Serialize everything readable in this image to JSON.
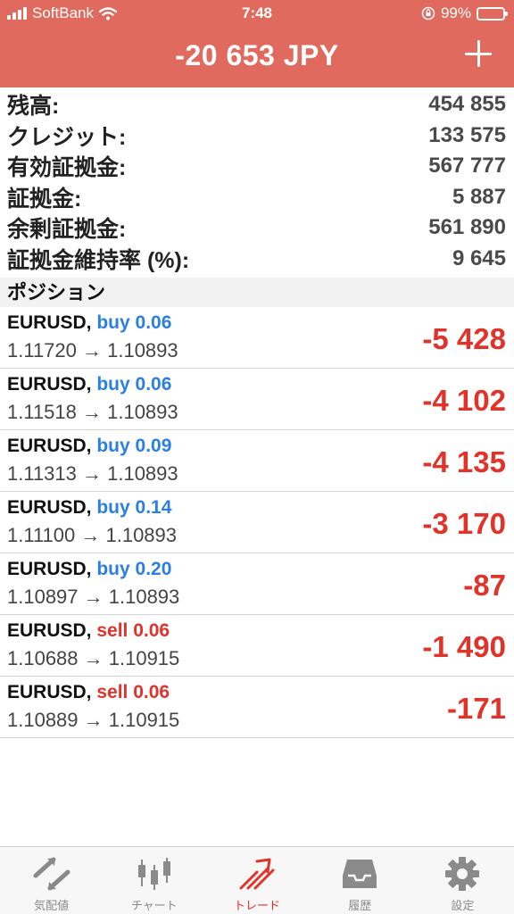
{
  "status_bar": {
    "carrier": "SoftBank",
    "time": "7:48",
    "battery": "99%"
  },
  "header": {
    "total": "-20 653 JPY"
  },
  "summary": [
    {
      "label": "残高:",
      "value": "454 855"
    },
    {
      "label": "クレジット:",
      "value": "133 575"
    },
    {
      "label": "有効証拠金:",
      "value": "567 777"
    },
    {
      "label": "証拠金:",
      "value": "5 887"
    },
    {
      "label": "余剰証拠金:",
      "value": "561 890"
    },
    {
      "label": "証拠金維持率 (%):",
      "value": "9 645"
    }
  ],
  "positions_title": "ポジション",
  "positions": [
    {
      "symbol": "EURUSD,",
      "side": "buy 0.06",
      "prices": "1.11720 → 1.10893",
      "profit": "-5 428"
    },
    {
      "symbol": "EURUSD,",
      "side": "buy 0.06",
      "prices": "1.11518 → 1.10893",
      "profit": "-4 102"
    },
    {
      "symbol": "EURUSD,",
      "side": "buy 0.09",
      "prices": "1.11313 → 1.10893",
      "profit": "-4 135"
    },
    {
      "symbol": "EURUSD,",
      "side": "buy 0.14",
      "prices": "1.11100 → 1.10893",
      "profit": "-3 170"
    },
    {
      "symbol": "EURUSD,",
      "side": "buy 0.20",
      "prices": "1.10897 → 1.10893",
      "profit": "-87"
    },
    {
      "symbol": "EURUSD,",
      "side": "sell 0.06",
      "prices": "1.10688 → 1.10915",
      "profit": "-1 490"
    },
    {
      "symbol": "EURUSD,",
      "side": "sell 0.06",
      "prices": "1.10889 → 1.10915",
      "profit": "-171"
    }
  ],
  "tabs": [
    {
      "label": "気配値",
      "icon": "quotes-icon"
    },
    {
      "label": "チャート",
      "icon": "chart-icon"
    },
    {
      "label": "トレード",
      "icon": "trade-icon",
      "active": true
    },
    {
      "label": "履歴",
      "icon": "history-icon"
    },
    {
      "label": "設定",
      "icon": "settings-icon"
    }
  ],
  "colors": {
    "header": "#e06a5e",
    "buy": "#2a7fe0",
    "sell": "#e0332a",
    "loss": "#e0332a"
  }
}
